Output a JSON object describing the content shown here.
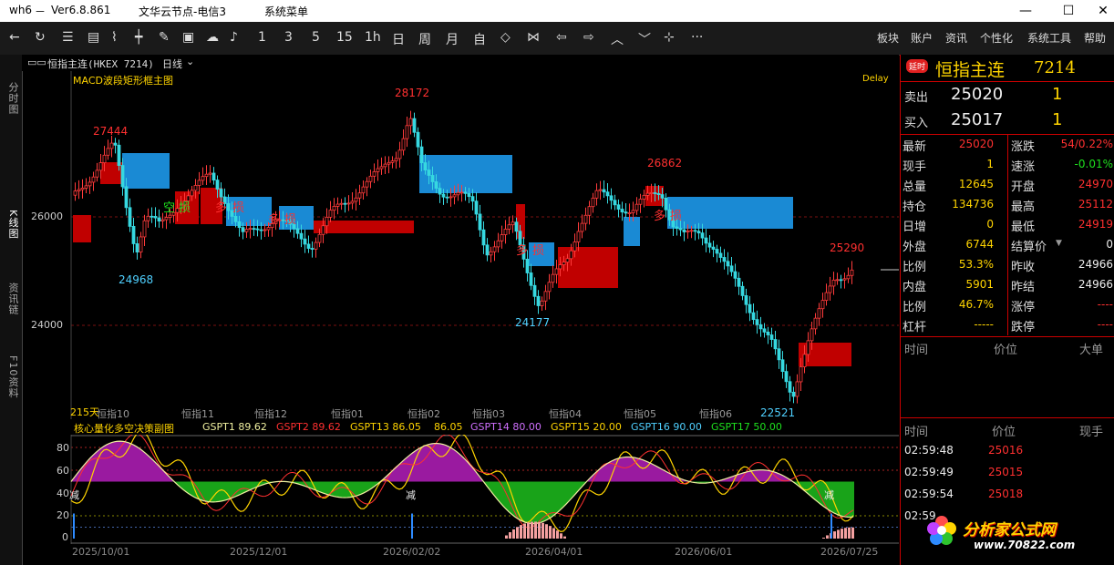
{
  "titlebar": {
    "app": "wh6",
    "dash": "－",
    "version": "Ver6.8.861",
    "server": "文华云节点-电信3",
    "menu": "系统菜单"
  },
  "toolbar": {
    "periods": [
      "1",
      "3",
      "5",
      "15",
      "1h",
      "日",
      "周",
      "月",
      "自"
    ],
    "menus": [
      "板块",
      "账户",
      "资讯",
      "个性化",
      "系统工具",
      "帮助"
    ]
  },
  "lefttabs": [
    "分时图",
    "K线图",
    "资讯链",
    "F10资料"
  ],
  "symbolbar": {
    "icon": "▭▭",
    "name": "恒指主连(HKEX 7214)",
    "period": "日线"
  },
  "main": {
    "indicator": "MACD波段矩形框主图",
    "delay": "Delay",
    "y_labels": [
      "26000",
      "24000"
    ],
    "days": "215天",
    "x_contracts": [
      "恒指10",
      "恒指11",
      "恒指12",
      "恒指01",
      "恒指02",
      "恒指03",
      "恒指04",
      "恒指05",
      "恒指06"
    ],
    "annotations": [
      "27444",
      "28172",
      "26862",
      "25290",
      "24968",
      "24177",
      "22521"
    ],
    "signals": [
      "空",
      "损",
      "多",
      "损",
      "多",
      "损",
      "多",
      "损",
      "多",
      "损"
    ]
  },
  "sub": {
    "name": "核心量化多空决策副图",
    "gspt": [
      {
        "label": "GSPT1 89.62",
        "color": "#f0f0a0"
      },
      {
        "label": "GSPT2 89.62",
        "color": "#ff3030"
      },
      {
        "label": "GSPT13 86.05",
        "color": "#ffd400"
      },
      {
        "label": "86.05",
        "color": "#ffd400"
      },
      {
        "label": "GSPT14 80.00",
        "color": "#d070ff"
      },
      {
        "label": "GSPT15 20.00",
        "color": "#ffd400"
      },
      {
        "label": "GSPT16 90.00",
        "color": "#4fd0ff"
      },
      {
        "label": "GSPT17 50.00",
        "color": "#1ee11e"
      }
    ],
    "y_labels": [
      "80",
      "60",
      "40",
      "20",
      "0"
    ],
    "reduce": [
      "减",
      "减",
      "减"
    ]
  },
  "xaxis": [
    "2025/10/01",
    "2025/12/01",
    "2026/02/02",
    "2026/04/01",
    "2026/06/01",
    "2026/07/25"
  ],
  "right": {
    "badge": "延时",
    "name": "恒指主连",
    "code": "7214",
    "sell_label": "卖出",
    "sell_price": "25020",
    "sell_vol": "1",
    "buy_label": "买入",
    "buy_price": "25017",
    "buy_vol": "1",
    "left_rows": [
      [
        "最新",
        "25020"
      ],
      [
        "现手",
        "1"
      ],
      [
        "总量",
        "12645"
      ],
      [
        "持仓",
        "134736"
      ],
      [
        "日增",
        "0"
      ],
      [
        "外盘",
        "6744"
      ],
      [
        "比例",
        "53.3%"
      ],
      [
        "内盘",
        "5901"
      ],
      [
        "比例",
        "46.7%"
      ],
      [
        "杠杆",
        "-----"
      ]
    ],
    "right_rows": [
      [
        "涨跌",
        "54/0.22%"
      ],
      [
        "速涨",
        "-0.01%"
      ],
      [
        "开盘",
        "24970"
      ],
      [
        "最高",
        "25112"
      ],
      [
        "最低",
        "24919"
      ],
      [
        "结算价",
        "0"
      ],
      [
        "昨收",
        "24966"
      ],
      [
        "昨结",
        "24966"
      ],
      [
        "涨停",
        "----"
      ],
      [
        "跌停",
        "----"
      ]
    ],
    "tick_header1": [
      "时间",
      "价位",
      "大单"
    ],
    "tick_header2": [
      "时间",
      "价位",
      "现手"
    ],
    "ticks": [
      [
        "02:59:48",
        "25016",
        ""
      ],
      [
        "02:59:49",
        "25015",
        ""
      ],
      [
        "02:59:54",
        "25018",
        ""
      ],
      [
        "02:59",
        "",
        ""
      ]
    ]
  },
  "watermark": {
    "text": "分析家公式网",
    "url": "www.70822.com"
  },
  "chart_data": {
    "type": "candlestick",
    "title": "恒指主连(HKEX 7214) 日线",
    "y_ticks": [
      26000,
      24000
    ],
    "labeled_points": [
      {
        "label": "27444"
      },
      {
        "label": "28172"
      },
      {
        "label": "26862"
      },
      {
        "label": "25290"
      },
      {
        "label": "24968"
      },
      {
        "label": "24177"
      },
      {
        "label": "22521"
      }
    ],
    "x_ticks": [
      "2025/10/01",
      "2025/12/01",
      "2026/02/02",
      "2026/04/01",
      "2026/06/01",
      "2026/07/25"
    ],
    "sub_y_ticks": [
      80,
      60,
      40,
      20,
      0
    ]
  }
}
